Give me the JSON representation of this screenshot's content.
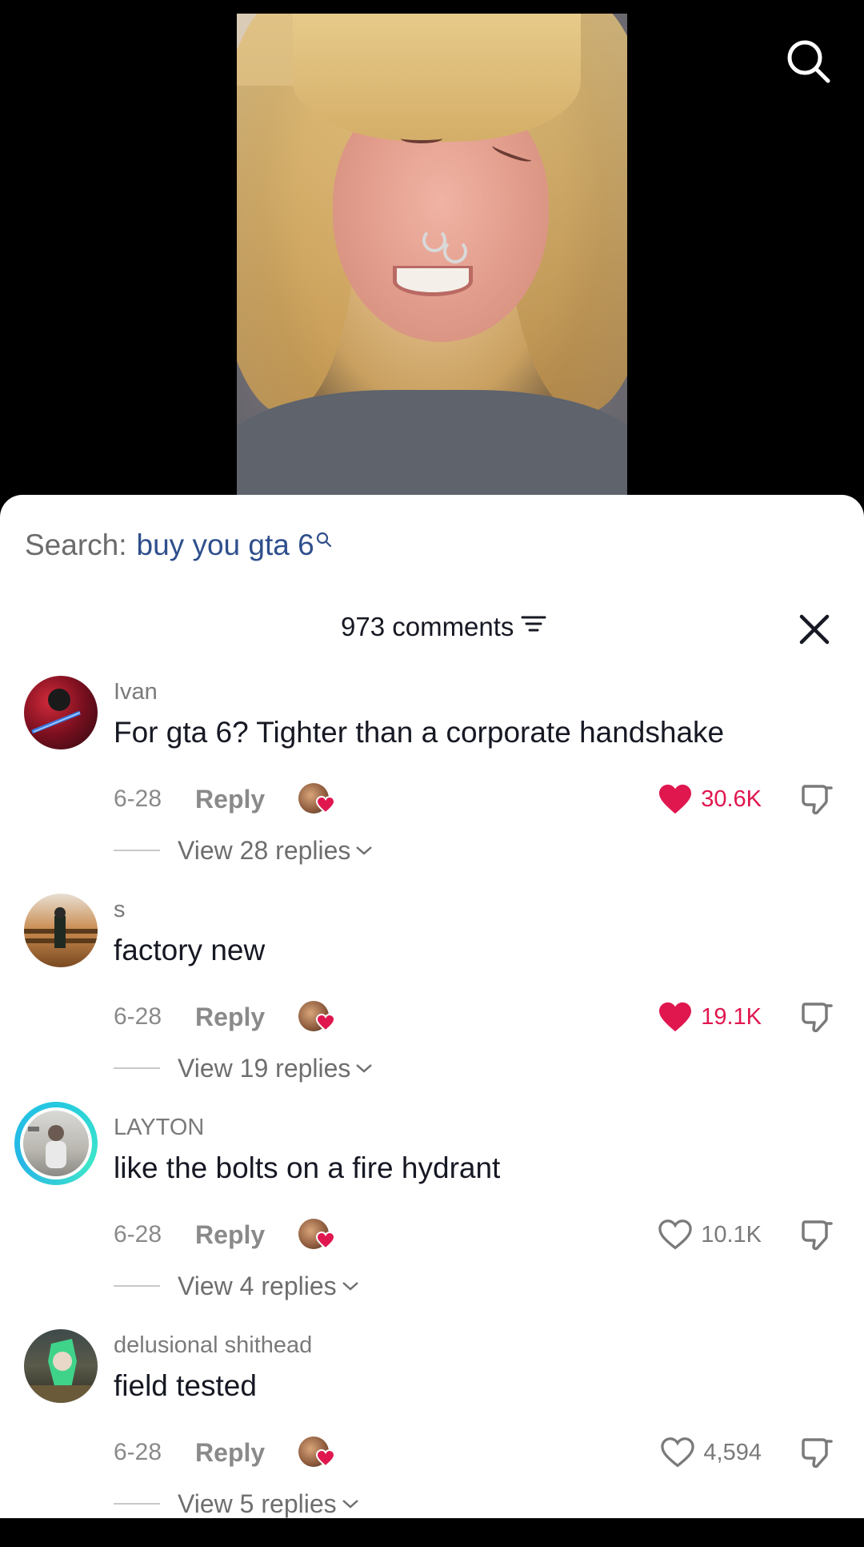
{
  "search": {
    "label": "Search:",
    "term": "buy you gta 6",
    "icon": "magnifier-icon"
  },
  "header": {
    "count_label": "973 comments",
    "sort_icon": "sort-lines-icon",
    "close_icon": "close-x-icon"
  },
  "colors": {
    "liked": "#e0174f",
    "search_term": "#2f4f8c",
    "text": "#161823",
    "muted": "#8a8a8a"
  },
  "comments": [
    {
      "username": "Ivan",
      "text": "For gta 6? Tighter than a corporate handshake",
      "date": "6-28",
      "reply_label": "Reply",
      "likes": "30.6K",
      "liked": true,
      "view_replies": "View 28 replies"
    },
    {
      "username": "s",
      "text": "factory new",
      "date": "6-28",
      "reply_label": "Reply",
      "likes": "19.1K",
      "liked": true,
      "view_replies": "View 19 replies"
    },
    {
      "username": "LAYTON",
      "text": "like the bolts on a fire hydrant",
      "date": "6-28",
      "reply_label": "Reply",
      "likes": "10.1K",
      "liked": false,
      "view_replies": "View 4 replies"
    },
    {
      "username": "delusional shithead",
      "text": "field tested",
      "date": "6-28",
      "reply_label": "Reply",
      "likes": "4,594",
      "liked": false,
      "view_replies": "View 5 replies"
    }
  ]
}
